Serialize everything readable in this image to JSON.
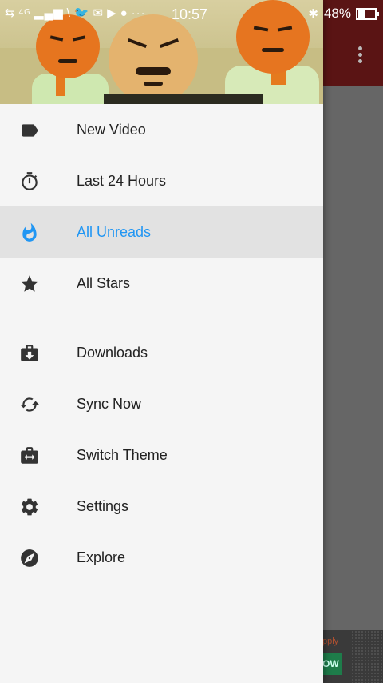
{
  "status_bar": {
    "network": "4G",
    "time": "10:57",
    "battery": "48%",
    "icons": [
      "data-arrows-icon",
      "signal-icon",
      "wifi-icon",
      "twitter-icon",
      "mail-icon",
      "youtube-icon",
      "maps-icon",
      "more-dots-icon",
      "bluetooth-icon",
      "battery-icon"
    ]
  },
  "drawer": {
    "header_image": "cartoon-characters-banner",
    "items_primary": [
      {
        "label": "New Video",
        "icon": "label-tag-icon",
        "active": false
      },
      {
        "label": "Last 24 Hours",
        "icon": "stopwatch-icon",
        "active": false
      },
      {
        "label": "All Unreads",
        "icon": "fire-icon",
        "active": true
      },
      {
        "label": "All Stars",
        "icon": "star-icon",
        "active": false
      }
    ],
    "items_secondary": [
      {
        "label": "Downloads",
        "icon": "download-briefcase-icon"
      },
      {
        "label": "Sync Now",
        "icon": "sync-icon"
      },
      {
        "label": "Switch Theme",
        "icon": "switch-theme-icon"
      },
      {
        "label": "Settings",
        "icon": "gear-icon"
      },
      {
        "label": "Explore",
        "icon": "compass-icon"
      }
    ]
  },
  "background": {
    "overflow_menu_icon": "more-vert-icon",
    "banner_small_text": "pply",
    "banner_cta": "OW"
  },
  "colors": {
    "accent": "#2196f3",
    "drawer_bg": "#f5f5f5",
    "active_bg": "#e2e2e2",
    "appbar": "#5a1414",
    "icon": "#333333"
  }
}
